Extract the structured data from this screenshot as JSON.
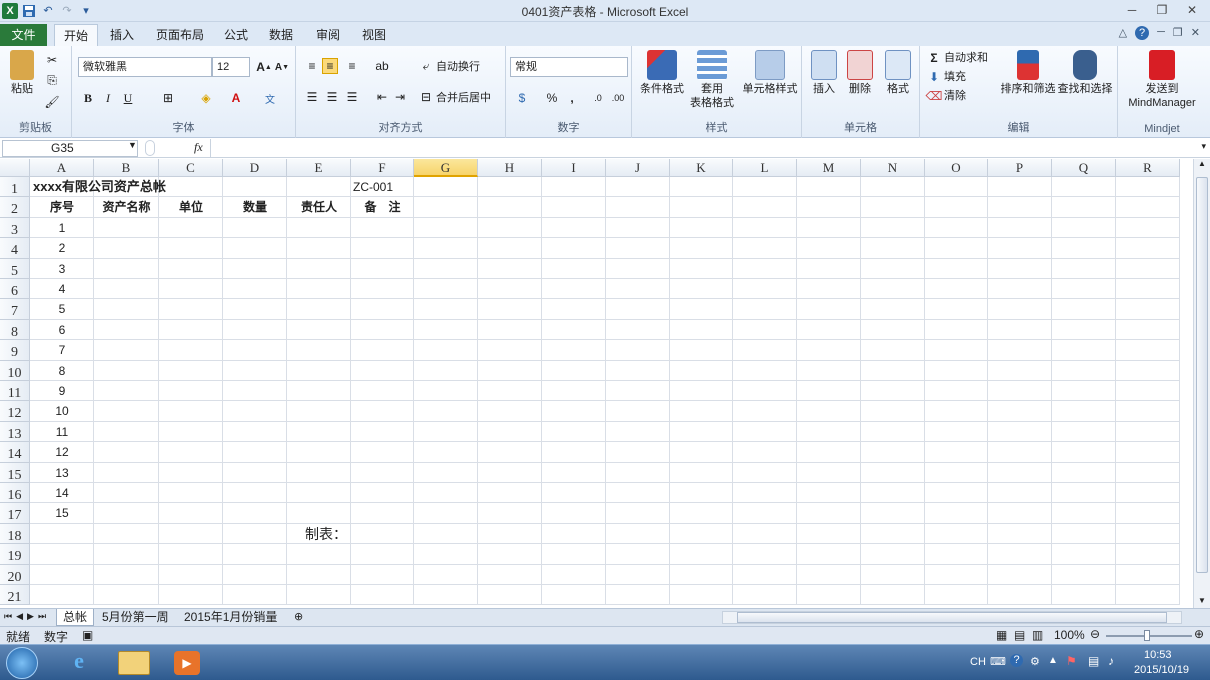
{
  "window": {
    "title": "0401资产表格 - Microsoft Excel"
  },
  "tabs": [
    "文件",
    "开始",
    "插入",
    "页面布局",
    "公式",
    "数据",
    "审阅",
    "视图"
  ],
  "ribbon": {
    "clipboard": {
      "paste": "粘贴",
      "label": "剪贴板"
    },
    "font": {
      "name": "微软雅黑",
      "size": "12",
      "label": "字体",
      "bold": "B",
      "italic": "I",
      "underline": "U"
    },
    "alignment": {
      "wrap": "自动换行",
      "merge": "合并后居中",
      "label": "对齐方式"
    },
    "number": {
      "format": "常规",
      "label": "数字",
      "percent": "%",
      "comma": ","
    },
    "styles": {
      "conditional": "条件格式",
      "table_line1": "套用",
      "table_line2": "表格格式",
      "cell_styles": "单元格样式",
      "label": "样式"
    },
    "cells": {
      "insert": "插入",
      "delete": "删除",
      "format": "格式",
      "label": "单元格"
    },
    "editing": {
      "autosum": "自动求和",
      "fill": "填充",
      "clear": "清除",
      "sort": "排序和筛选",
      "find": "查找和选择",
      "label": "编辑"
    },
    "mindjet": {
      "send_line1": "发送到",
      "send_line2": "MindManager",
      "label": "Mindjet"
    }
  },
  "formula_bar": {
    "name_box": "G35",
    "fx": "fx",
    "formula": ""
  },
  "columns": [
    "A",
    "B",
    "C",
    "D",
    "E",
    "F",
    "G",
    "H",
    "I",
    "J",
    "K",
    "L",
    "M",
    "N",
    "O",
    "P",
    "Q",
    "R"
  ],
  "selected_column": "G",
  "rows": [
    "1",
    "2",
    "3",
    "4",
    "5",
    "6",
    "7",
    "8",
    "9",
    "10",
    "11",
    "12",
    "13",
    "14",
    "15",
    "16",
    "17",
    "18",
    "19",
    "20",
    "21"
  ],
  "cells": {
    "title": "xxxx有限公司资产总帐",
    "code": "ZC-001",
    "headers": [
      "序号",
      "资产名称",
      "单位",
      "数量",
      "责任人",
      "备　注"
    ],
    "serials": [
      "1",
      "2",
      "3",
      "4",
      "5",
      "6",
      "7",
      "8",
      "9",
      "10",
      "11",
      "12",
      "13",
      "14",
      "15"
    ],
    "maker": "制表："
  },
  "sheet_tabs": [
    "总帐",
    "5月份第一周",
    "2015年1月份销量"
  ],
  "status": {
    "ready": "就绪",
    "mode": "数字",
    "zoom": "100%"
  },
  "taskbar": {
    "lang": "CH",
    "time": "10:53",
    "date": "2015/10/19"
  }
}
